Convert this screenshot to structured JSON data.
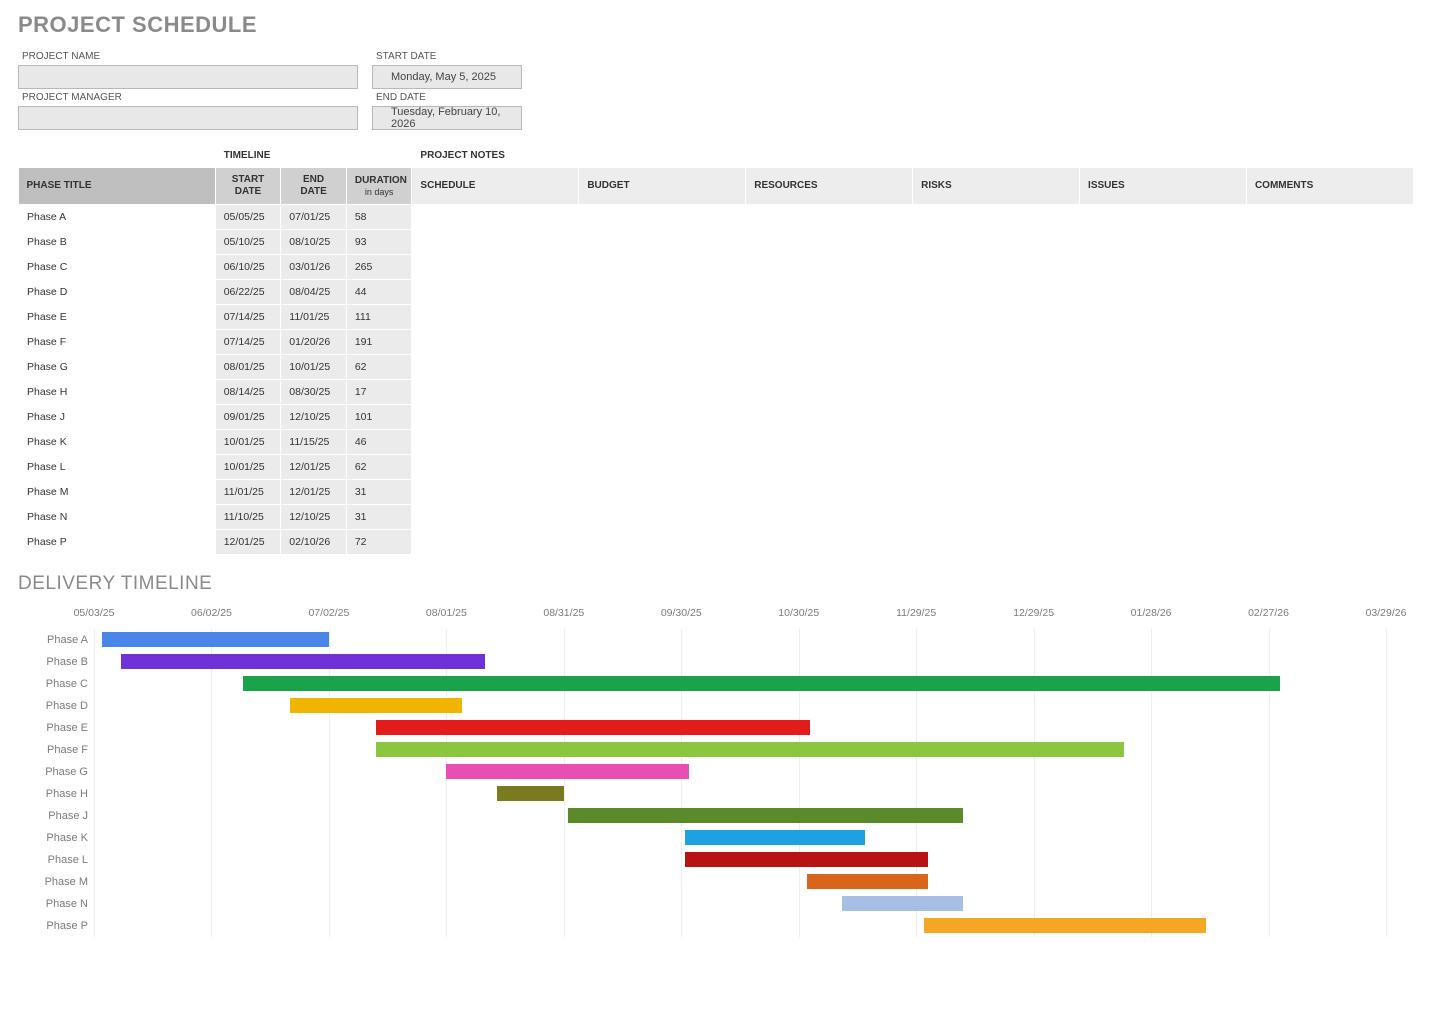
{
  "title": "PROJECT SCHEDULE",
  "meta": {
    "project_name_label": "PROJECT NAME",
    "project_name_value": "",
    "project_manager_label": "PROJECT MANAGER",
    "project_manager_value": "",
    "start_date_label": "START DATE",
    "start_date_value": "Monday, May 5, 2025",
    "end_date_label": "END DATE",
    "end_date_value": "Tuesday, February 10, 2026"
  },
  "table_headers": {
    "super_timeline": "TIMELINE",
    "super_notes": "PROJECT NOTES",
    "phase_title": "PHASE TITLE",
    "start_date": "START DATE",
    "end_date": "END DATE",
    "duration": "DURATION",
    "duration_sub": "in days",
    "notes": [
      "SCHEDULE",
      "BUDGET",
      "RESOURCES",
      "RISKS",
      "ISSUES",
      "COMMENTS"
    ]
  },
  "phases": [
    {
      "name": "Phase A",
      "start": "05/05/25",
      "end": "07/01/25",
      "dur": "58"
    },
    {
      "name": "Phase B",
      "start": "05/10/25",
      "end": "08/10/25",
      "dur": "93"
    },
    {
      "name": "Phase C",
      "start": "06/10/25",
      "end": "03/01/26",
      "dur": "265"
    },
    {
      "name": "Phase D",
      "start": "06/22/25",
      "end": "08/04/25",
      "dur": "44"
    },
    {
      "name": "Phase E",
      "start": "07/14/25",
      "end": "11/01/25",
      "dur": "111"
    },
    {
      "name": "Phase F",
      "start": "07/14/25",
      "end": "01/20/26",
      "dur": "191"
    },
    {
      "name": "Phase G",
      "start": "08/01/25",
      "end": "10/01/25",
      "dur": "62"
    },
    {
      "name": "Phase H",
      "start": "08/14/25",
      "end": "08/30/25",
      "dur": "17"
    },
    {
      "name": "Phase J",
      "start": "09/01/25",
      "end": "12/10/25",
      "dur": "101"
    },
    {
      "name": "Phase K",
      "start": "10/01/25",
      "end": "11/15/25",
      "dur": "46"
    },
    {
      "name": "Phase L",
      "start": "10/01/25",
      "end": "12/01/25",
      "dur": "62"
    },
    {
      "name": "Phase M",
      "start": "11/01/25",
      "end": "12/01/25",
      "dur": "31"
    },
    {
      "name": "Phase N",
      "start": "11/10/25",
      "end": "12/10/25",
      "dur": "31"
    },
    {
      "name": "Phase P",
      "start": "12/01/25",
      "end": "02/10/26",
      "dur": "72"
    }
  ],
  "delivery_title": "DELIVERY TIMELINE",
  "chart_data": {
    "type": "gantt",
    "x_axis_labels": [
      "05/03/25",
      "06/02/25",
      "07/02/25",
      "08/01/25",
      "08/31/25",
      "09/30/25",
      "10/30/25",
      "11/29/25",
      "12/29/25",
      "01/28/26",
      "02/27/26",
      "03/29/26"
    ],
    "x_min": "05/03/25",
    "x_max": "03/29/26",
    "bars": [
      {
        "label": "Phase A",
        "start": "05/05/25",
        "duration": 58,
        "color": "#4a86e8"
      },
      {
        "label": "Phase B",
        "start": "05/10/25",
        "duration": 93,
        "color": "#6f32d8"
      },
      {
        "label": "Phase C",
        "start": "06/10/25",
        "duration": 265,
        "color": "#1aa34a"
      },
      {
        "label": "Phase D",
        "start": "06/22/25",
        "duration": 44,
        "color": "#f1b400"
      },
      {
        "label": "Phase E",
        "start": "07/14/25",
        "duration": 111,
        "color": "#e31b1b"
      },
      {
        "label": "Phase F",
        "start": "07/14/25",
        "duration": 191,
        "color": "#8cc63f"
      },
      {
        "label": "Phase G",
        "start": "08/01/25",
        "duration": 62,
        "color": "#e84fb1"
      },
      {
        "label": "Phase H",
        "start": "08/14/25",
        "duration": 17,
        "color": "#7a7a1f"
      },
      {
        "label": "Phase J",
        "start": "09/01/25",
        "duration": 101,
        "color": "#5b8a2a"
      },
      {
        "label": "Phase K",
        "start": "10/01/25",
        "duration": 46,
        "color": "#1ea1e0"
      },
      {
        "label": "Phase L",
        "start": "10/01/25",
        "duration": 62,
        "color": "#b81313"
      },
      {
        "label": "Phase M",
        "start": "11/01/25",
        "duration": 31,
        "color": "#d8651b"
      },
      {
        "label": "Phase N",
        "start": "11/10/25",
        "duration": 31,
        "color": "#a6c0e4"
      },
      {
        "label": "Phase P",
        "start": "12/01/25",
        "duration": 72,
        "color": "#f5a623"
      }
    ]
  }
}
